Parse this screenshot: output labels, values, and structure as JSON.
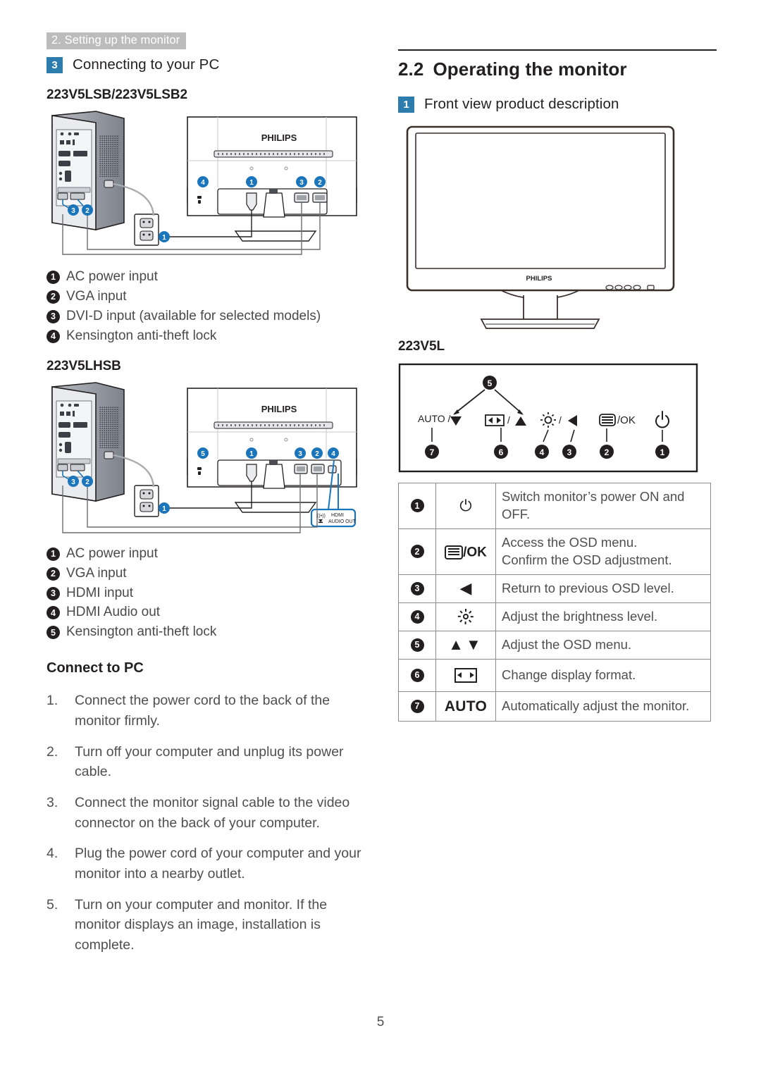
{
  "running_header": "2. Setting up the monitor",
  "page_number": "5",
  "colors": {
    "badge_blue": "#2c7cad",
    "header_gray": "#bcbcbc",
    "callout_blue": "#1b75bb",
    "text": "#231f20"
  },
  "left_column": {
    "section": {
      "number": "3",
      "title": "Connecting to your PC"
    },
    "figure1": {
      "model": "223V5LSB/223V5LSB2",
      "brand": "PHILIPS",
      "callouts": [
        "4",
        "1",
        "3",
        "2",
        "1",
        "3",
        "2"
      ]
    },
    "list1": [
      {
        "n": "1",
        "text": "AC power input"
      },
      {
        "n": "2",
        "text": "VGA input"
      },
      {
        "n": "3",
        "text": "DVI-D input (available for selected models)"
      },
      {
        "n": "4",
        "text": "Kensington anti-theft lock"
      }
    ],
    "figure2": {
      "model": "223V5LHSB",
      "brand": "PHILIPS",
      "audio_label_line1": "HDMI",
      "audio_label_line2": "AUDIO OUT",
      "callouts": [
        "5",
        "1",
        "3",
        "2",
        "4",
        "1",
        "3",
        "2"
      ]
    },
    "list2": [
      {
        "n": "1",
        "text": "AC power input"
      },
      {
        "n": "2",
        "text": "VGA input"
      },
      {
        "n": "3",
        "text": "HDMI input"
      },
      {
        "n": "4",
        "text": "HDMI Audio out"
      },
      {
        "n": "5",
        "text": "Kensington anti-theft lock"
      }
    ],
    "connect_heading": "Connect to PC",
    "steps": [
      {
        "n": "1.",
        "text": "Connect the power cord to the back of the monitor firmly."
      },
      {
        "n": "2.",
        "text": "Turn off your computer and unplug its power cable."
      },
      {
        "n": "3.",
        "text": "Connect the monitor signal cable to the video connector on the back of your computer."
      },
      {
        "n": "4.",
        "text": "Plug the power cord of your computer and your monitor into a nearby outlet."
      },
      {
        "n": "5.",
        "text": "Turn on your computer and monitor. If the monitor displays an image,  installation is complete."
      }
    ]
  },
  "right_column": {
    "h2": {
      "number": "2.2",
      "title": "Operating the monitor"
    },
    "section": {
      "number": "1",
      "title": "Front view product description"
    },
    "front_view": {
      "brand": "PHILIPS"
    },
    "control_panel": {
      "model": "223V5L",
      "top_callout": "5",
      "keys": [
        {
          "label": "AUTO /",
          "glyph": "down-triangle",
          "callout": "7"
        },
        {
          "label": "display-format /",
          "glyph": "up-triangle",
          "callout": "6"
        },
        {
          "label": "brightness /",
          "glyph": "left-triangle",
          "callout": "4"
        },
        {
          "label": "",
          "glyph": "left-triangle",
          "callout": "3"
        },
        {
          "label": "/OK",
          "glyph": "osd-menu",
          "callout": "2"
        },
        {
          "label": "",
          "glyph": "power",
          "callout": "1"
        }
      ],
      "auto_text": "AUTO",
      "ok_text": "/OK"
    },
    "table": [
      {
        "n": "1",
        "icon": "power-icon",
        "icon_text": "",
        "desc": [
          "Switch monitor’s power ON and",
          "OFF."
        ]
      },
      {
        "n": "2",
        "icon": "osd-menu-icon",
        "icon_text": "/OK",
        "desc": [
          "Access the OSD menu.",
          "Confirm the OSD adjustment."
        ]
      },
      {
        "n": "3",
        "icon": "left-triangle-icon",
        "icon_text": "",
        "desc": [
          "Return to previous OSD level."
        ]
      },
      {
        "n": "4",
        "icon": "brightness-icon",
        "icon_text": "",
        "desc": [
          "Adjust the brightness level."
        ]
      },
      {
        "n": "5",
        "icon": "up-down-triangle-icon",
        "icon_text": "",
        "desc": [
          "Adjust the OSD menu."
        ]
      },
      {
        "n": "6",
        "icon": "display-format-icon",
        "icon_text": "",
        "desc": [
          "Change display format."
        ]
      },
      {
        "n": "7",
        "icon": "auto-icon",
        "icon_text": "AUTO",
        "desc": [
          "Automatically adjust the monitor."
        ]
      }
    ]
  }
}
